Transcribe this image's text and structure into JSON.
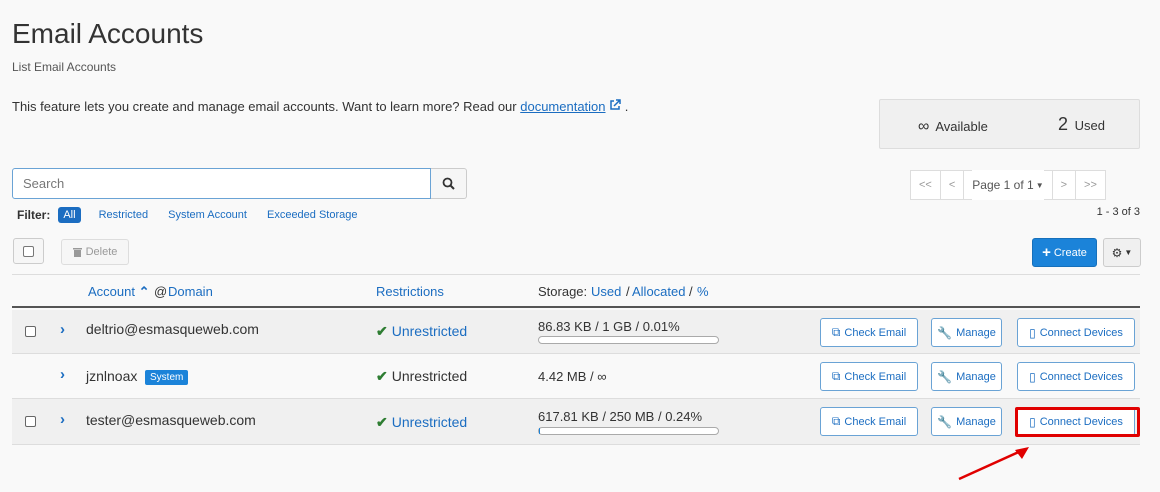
{
  "header": {
    "title": "Email Accounts",
    "subtitle": "List Email Accounts",
    "intro_text": "This feature lets you create and manage email accounts. Want to learn more? Read our ",
    "doc_link": "documentation",
    "intro_end": "."
  },
  "stats": {
    "available_symbol": "∞",
    "available_label": "Available",
    "used_count": "2",
    "used_label": "Used"
  },
  "search": {
    "placeholder": "Search"
  },
  "pagination": {
    "first": "<<",
    "prev": "<",
    "page_label": "Page 1 of 1",
    "next": ">",
    "last": ">>",
    "range": "1 - 3 of 3"
  },
  "filter": {
    "label": "Filter:",
    "options": [
      "All",
      "Restricted",
      "System Account",
      "Exceeded Storage"
    ],
    "selected": "All"
  },
  "toolbar": {
    "delete_label": "Delete",
    "create_label": "Create"
  },
  "table": {
    "col_account": "Account",
    "col_at": "@",
    "col_domain": "Domain",
    "col_restrictions": "Restrictions",
    "col_storage_prefix": "Storage:",
    "col_used": "Used",
    "col_allocated": "Allocated",
    "col_percent": "%",
    "sep": "/"
  },
  "rows": [
    {
      "account": "deltrio@esmasqueweb.com",
      "badge": "",
      "restriction": "Unrestricted",
      "storage": "86.83 KB / 1 GB / 0.01%",
      "usage_fraction": 0.0001
    },
    {
      "account": "jznlnoax",
      "badge": "System",
      "restriction": "Unrestricted",
      "storage": "4.42 MB / ∞",
      "usage_fraction": null
    },
    {
      "account": "tester@esmasqueweb.com",
      "badge": "",
      "restriction": "Unrestricted",
      "storage": "617.81 KB / 250 MB / 0.24%",
      "usage_fraction": 0.0024
    }
  ],
  "actions": {
    "check_email": "Check Email",
    "manage": "Manage",
    "connect_devices": "Connect Devices"
  },
  "colors": {
    "primary": "#1b83d9",
    "link": "#1b6dc1",
    "check": "#2e7d32",
    "highlight": "#e00000"
  }
}
